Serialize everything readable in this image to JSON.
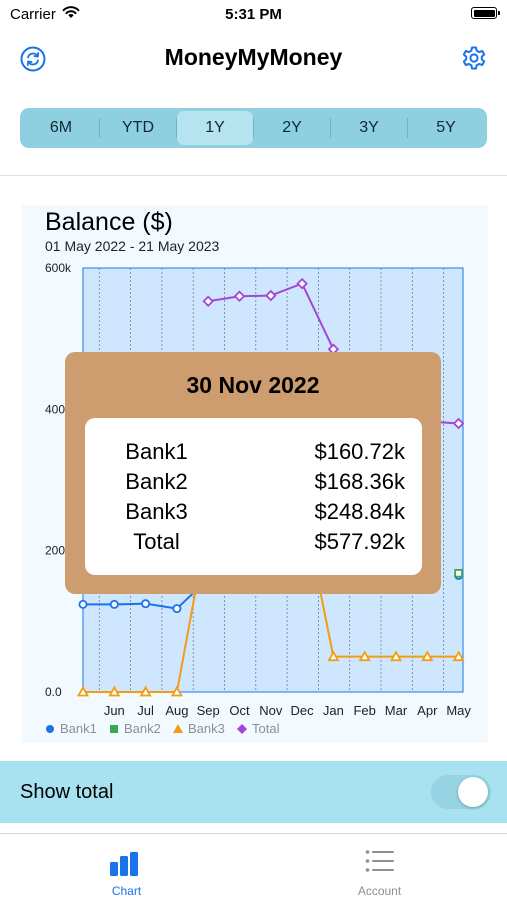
{
  "status_bar": {
    "carrier": "Carrier",
    "time": "5:31 PM"
  },
  "nav": {
    "title": "MoneyMyMoney",
    "refresh_icon": "refresh-icon",
    "settings_icon": "gear-icon"
  },
  "periods": {
    "options": [
      "6M",
      "YTD",
      "1Y",
      "2Y",
      "3Y",
      "5Y"
    ],
    "selected": "1Y"
  },
  "chart_data": {
    "type": "line",
    "title": "Balance  ($)",
    "subtitle": "01 May 2022 - 21 May 2023",
    "categories": [
      "May",
      "Jun",
      "Jul",
      "Aug",
      "Sep",
      "Oct",
      "Nov",
      "Dec",
      "Jan",
      "Feb",
      "Mar",
      "Apr",
      "May"
    ],
    "x_tick_labels": [
      "Jun",
      "Jul",
      "Aug",
      "Sep",
      "Oct",
      "Nov",
      "Dec",
      "Jan",
      "Feb",
      "Mar",
      "Apr",
      "May"
    ],
    "y_tick_labels": [
      "0.0",
      "200k",
      "400k",
      "600k"
    ],
    "ylim": [
      0,
      600000
    ],
    "grid": true,
    "legend_position": "bottom-left",
    "series": [
      {
        "name": "Bank1",
        "color": "#1a73e8",
        "marker": "circle",
        "values": [
          124000,
          124000,
          125000,
          118000,
          160000,
          null,
          160720,
          null,
          null,
          null,
          null,
          null,
          165000
        ]
      },
      {
        "name": "Bank2",
        "color": "#34a853",
        "marker": "square",
        "values": [
          null,
          null,
          null,
          null,
          null,
          null,
          168360,
          null,
          null,
          null,
          null,
          null,
          168000
        ]
      },
      {
        "name": "Bank3",
        "color": "#f29d12",
        "marker": "triangle",
        "values": [
          0,
          0,
          0,
          0,
          240000,
          null,
          248840,
          270000,
          50000,
          50000,
          50000,
          50000,
          50000
        ]
      },
      {
        "name": "Total",
        "color": "#a445d6",
        "marker": "diamond",
        "values": [
          null,
          null,
          null,
          null,
          553000,
          560000,
          561000,
          577920,
          485000,
          385000,
          385000,
          383000,
          380000
        ]
      }
    ]
  },
  "tooltip": {
    "date": "30 Nov 2022",
    "rows": [
      {
        "name": "Bank1",
        "value": "$160.72k"
      },
      {
        "name": "Bank2",
        "value": "$168.36k"
      },
      {
        "name": "Bank3",
        "value": "$248.84k"
      },
      {
        "name": "Total",
        "value": "$577.92k"
      }
    ]
  },
  "toggle": {
    "label": "Show total",
    "on": true
  },
  "tabs": [
    {
      "label": "Chart",
      "icon": "bar-chart-icon",
      "active": true
    },
    {
      "label": "Account",
      "icon": "list-icon",
      "active": false
    }
  ],
  "colors": {
    "accent": "#1a73e8",
    "segment_bg": "#8ecfe0",
    "toggle_row_bg": "#a8e1ef",
    "tooltip_bg": "#cd9c6f",
    "plot_bg": "#cfe6ff"
  }
}
